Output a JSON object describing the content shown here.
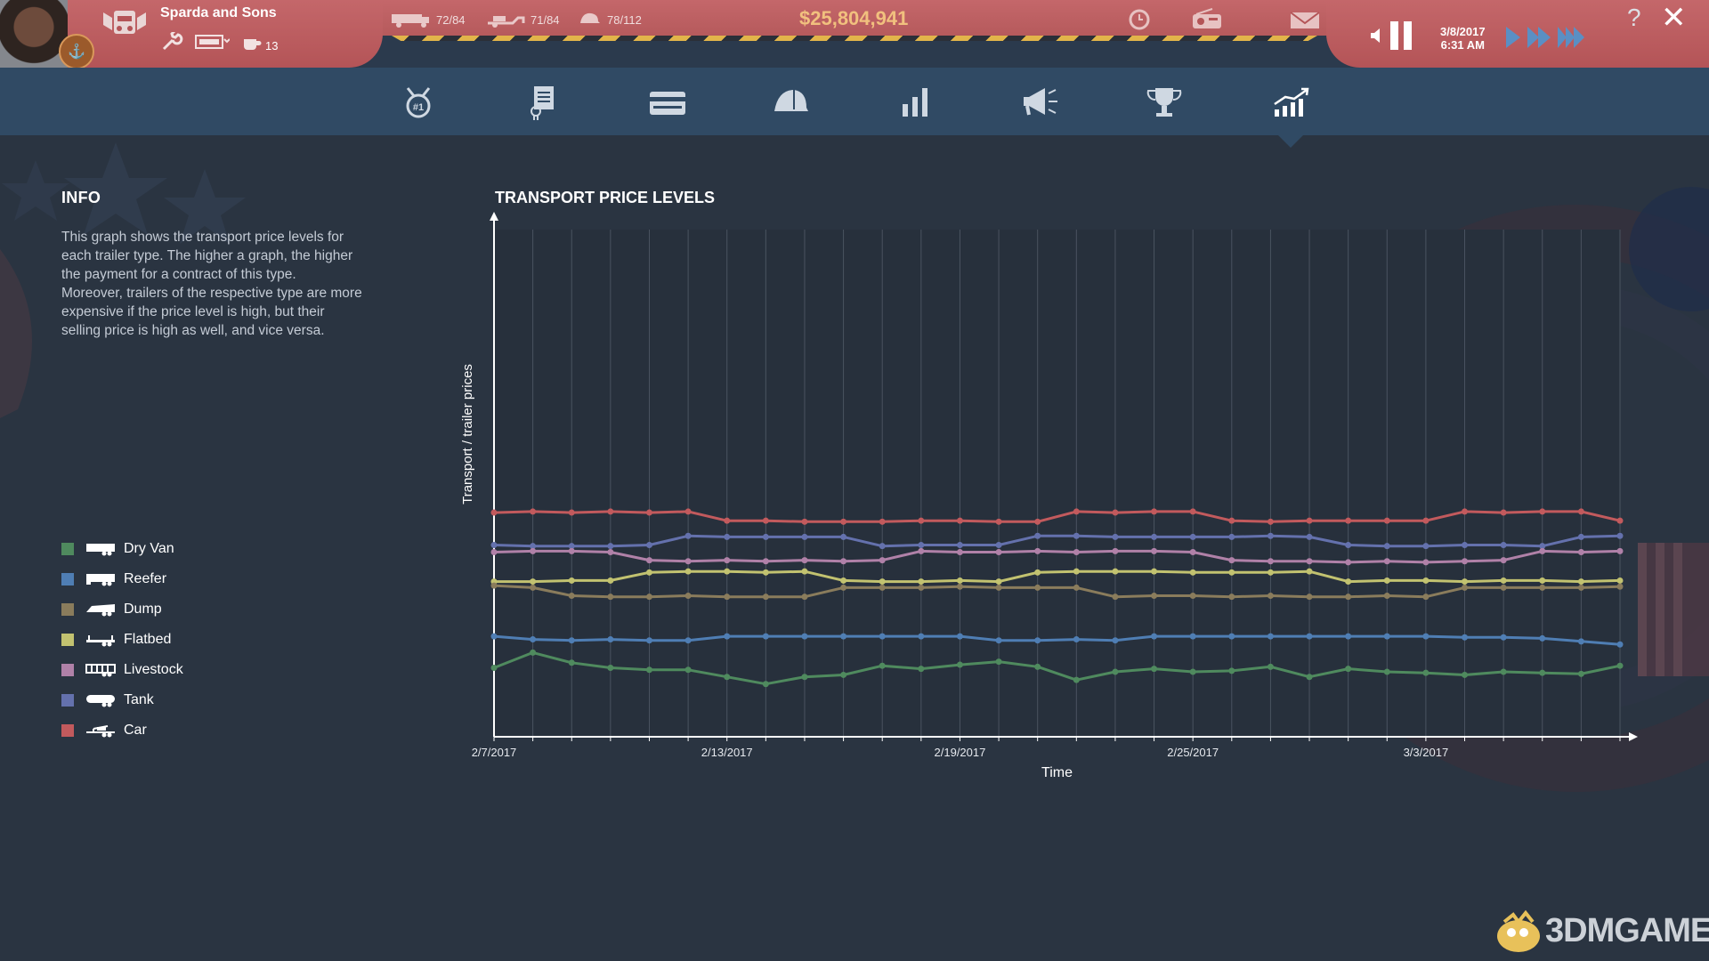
{
  "company": {
    "name": "Sparda and Sons",
    "staff_count": "13"
  },
  "stats": [
    {
      "icon": "truck-icon",
      "value": "72/84"
    },
    {
      "icon": "trailer-icon",
      "value": "71/84"
    },
    {
      "icon": "driver-cap-icon",
      "value": "78/112"
    }
  ],
  "money": "$25,804,941",
  "datetime": {
    "date": "3/8/2017",
    "time": "6:31 AM"
  },
  "topbar_icons": [
    "help-icon",
    "close-icon"
  ],
  "nav_tabs": [
    {
      "name": "reputation-tab",
      "icon": "medal-icon"
    },
    {
      "name": "contracts-tab",
      "icon": "document-icon"
    },
    {
      "name": "finances-tab",
      "icon": "card-icon"
    },
    {
      "name": "staff-tab",
      "icon": "cap-icon"
    },
    {
      "name": "statistics-tab",
      "icon": "bar-chart-icon"
    },
    {
      "name": "marketing-tab",
      "icon": "megaphone-icon"
    },
    {
      "name": "ranking-tab",
      "icon": "trophy-icon"
    },
    {
      "name": "market-trends-tab",
      "icon": "trend-chart-icon",
      "active": true
    }
  ],
  "info": {
    "title": "INFO",
    "paragraph1": "This graph shows the transport price levels for each trailer type. The higher a graph, the higher the payment for a contract of this type.",
    "paragraph2": "Moreover, trailers of the respective type are more expensive if the price level is high, but their selling price is high as well, and vice versa."
  },
  "legend": [
    {
      "label": "Dry Van",
      "color": "#4f8a5e"
    },
    {
      "label": "Reefer",
      "color": "#4f7eb4"
    },
    {
      "label": "Dump",
      "color": "#8a7c5c"
    },
    {
      "label": "Flatbed",
      "color": "#c2c270"
    },
    {
      "label": "Livestock",
      "color": "#b081a8"
    },
    {
      "label": "Tank",
      "color": "#6471ad"
    },
    {
      "label": "Car",
      "color": "#c25a5d"
    }
  ],
  "chart_data": {
    "type": "line",
    "title": "TRANSPORT PRICE LEVELS",
    "xlabel": "Time",
    "ylabel": "Transport / trailer prices",
    "x_tick_labels": [
      "2/7/2017",
      "2/13/2017",
      "2/19/2017",
      "2/25/2017",
      "3/3/2017"
    ],
    "x_tick_index": [
      0,
      6,
      12,
      18,
      24
    ],
    "ylim": [
      0,
      100
    ],
    "grid": true,
    "legend_position": "left",
    "series": [
      {
        "name": "Car",
        "color": "#c25a5d",
        "values": [
          44.2,
          44.4,
          44.2,
          44.4,
          44.2,
          44.4,
          42.6,
          42.6,
          42.4,
          42.4,
          42.4,
          42.6,
          42.6,
          42.4,
          42.4,
          44.4,
          44.2,
          44.4,
          44.4,
          42.6,
          42.4,
          42.6,
          42.6,
          42.6,
          42.6,
          44.4,
          44.2,
          44.4,
          44.4,
          42.6
        ]
      },
      {
        "name": "Tank",
        "color": "#6471ad",
        "values": [
          37.8,
          37.6,
          37.6,
          37.6,
          37.8,
          39.6,
          39.4,
          39.4,
          39.4,
          39.4,
          37.6,
          37.8,
          37.8,
          37.8,
          39.6,
          39.6,
          39.4,
          39.4,
          39.4,
          39.4,
          39.6,
          39.4,
          37.8,
          37.6,
          37.6,
          37.8,
          37.8,
          37.6,
          39.4,
          39.6
        ]
      },
      {
        "name": "Livestock",
        "color": "#b081a8",
        "values": [
          36.4,
          36.6,
          36.6,
          36.4,
          34.8,
          34.6,
          34.8,
          34.6,
          34.8,
          34.6,
          34.8,
          36.6,
          36.4,
          36.4,
          36.6,
          36.4,
          36.6,
          36.6,
          36.4,
          34.8,
          34.6,
          34.6,
          34.4,
          34.6,
          34.4,
          34.6,
          34.8,
          36.6,
          36.4,
          36.6
        ]
      },
      {
        "name": "Flatbed",
        "color": "#c2c270",
        "values": [
          30.6,
          30.6,
          30.8,
          30.8,
          32.4,
          32.6,
          32.6,
          32.4,
          32.6,
          30.8,
          30.6,
          30.6,
          30.8,
          30.6,
          32.4,
          32.6,
          32.6,
          32.6,
          32.4,
          32.4,
          32.4,
          32.6,
          30.6,
          30.8,
          30.8,
          30.6,
          30.8,
          30.8,
          30.6,
          30.8
        ]
      },
      {
        "name": "Dump",
        "color": "#8a7c5c",
        "values": [
          29.8,
          29.4,
          27.8,
          27.6,
          27.6,
          27.8,
          27.6,
          27.6,
          27.6,
          29.4,
          29.4,
          29.4,
          29.6,
          29.4,
          29.4,
          29.4,
          27.6,
          27.8,
          27.8,
          27.6,
          27.8,
          27.6,
          27.6,
          27.8,
          27.6,
          29.4,
          29.4,
          29.4,
          29.4,
          29.6
        ]
      },
      {
        "name": "Reefer",
        "color": "#4f7eb4",
        "values": [
          19.8,
          19.2,
          19.0,
          19.2,
          19.0,
          19.0,
          19.8,
          19.8,
          19.8,
          19.8,
          19.8,
          19.8,
          19.8,
          19.0,
          19.0,
          19.2,
          19.0,
          19.8,
          19.8,
          19.8,
          19.8,
          19.8,
          19.8,
          19.8,
          19.8,
          19.6,
          19.6,
          19.4,
          18.8,
          18.2
        ]
      },
      {
        "name": "Dry Van",
        "color": "#4f8a5e",
        "values": [
          13.6,
          16.6,
          14.6,
          13.6,
          13.2,
          13.2,
          11.8,
          10.4,
          11.8,
          12.2,
          14.0,
          13.4,
          14.2,
          14.8,
          13.8,
          11.2,
          12.8,
          13.4,
          12.8,
          13.0,
          13.8,
          11.8,
          13.4,
          12.8,
          12.6,
          12.2,
          12.8,
          12.6,
          12.4,
          14.0
        ]
      }
    ]
  },
  "watermark": "3DMGAME"
}
